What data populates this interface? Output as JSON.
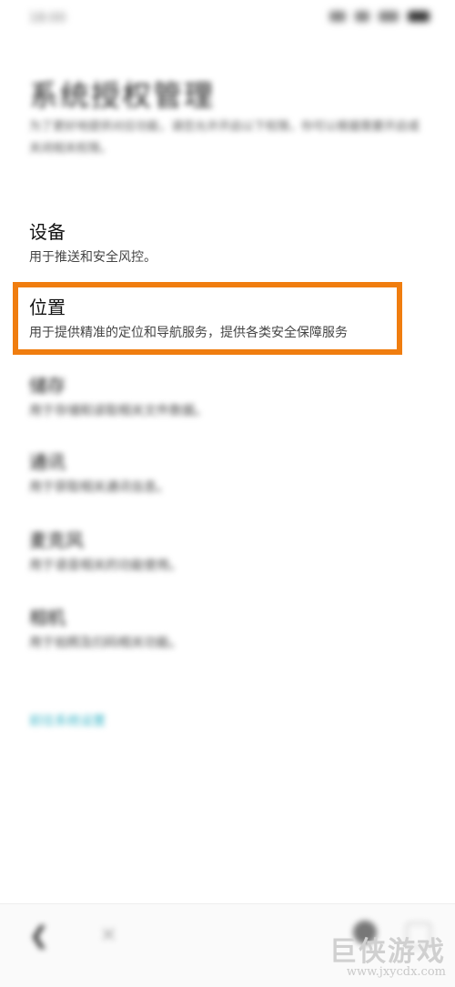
{
  "status_bar": {
    "time": "18:00"
  },
  "header": {
    "title": "系统授权管理",
    "description": "为了更好地提供对应功能，请您允许开启以下权限，你可以根据需要开启或关闭相关权限。"
  },
  "permissions": [
    {
      "title": "设备",
      "description": "用于推送和安全风控。"
    },
    {
      "title": "位置",
      "description": "用于提供精准的定位和导航服务，提供各类安全保障服务"
    },
    {
      "title": "储存",
      "description": "用于存储和读取相关文件数据。"
    },
    {
      "title": "通讯",
      "description": "用于获取相关通讯信息。"
    },
    {
      "title": "麦克风",
      "description": "用于语音相关的功能使用。"
    },
    {
      "title": "相机",
      "description": "用于拍照及扫码相关功能。"
    }
  ],
  "link": {
    "label": "前往系统设置"
  },
  "navigation": {
    "back_icon": "chevron-left-icon",
    "close_icon": "close-icon",
    "refresh_icon": "refresh-icon",
    "more_icon": "more-icon"
  },
  "watermark": {
    "name": "巨侠游戏",
    "url": "www.jxycdx.com"
  },
  "colors": {
    "highlight": "#f07d0f",
    "link": "#3fb7c8"
  }
}
